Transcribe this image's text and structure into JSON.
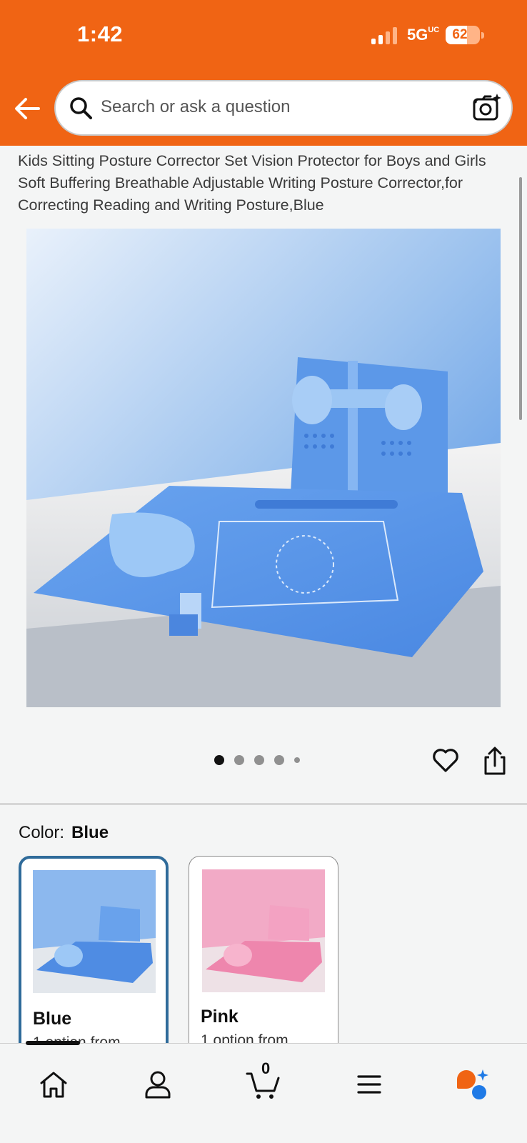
{
  "status": {
    "time": "1:42",
    "network": "5G",
    "network_sup": "UC",
    "battery": "62",
    "battery_level": 0.62
  },
  "search": {
    "placeholder": "Search or ask a question"
  },
  "product": {
    "title": "Kids Sitting Posture Corrector Set Vision Protector for Boys and Girls Soft Buffering Breathable Adjustable Writing Posture Corrector,for Correcting Reading and Writing Posture,Blue",
    "image_count": 5,
    "active_image": 0
  },
  "color": {
    "label": "Color:",
    "selected": "Blue",
    "options": [
      {
        "name": "Blue",
        "sub": "1 option from",
        "accent": "#5d9be8"
      },
      {
        "name": "Pink",
        "sub": "1 option from",
        "accent": "#f08fb1"
      }
    ]
  },
  "nav": {
    "cart_count": "0",
    "items": [
      "home-icon",
      "account-icon",
      "cart-icon",
      "menu-icon",
      "rufus-icon"
    ]
  },
  "colors": {
    "brand": "#f06414",
    "selected_border": "#2f6b9a",
    "rufus_orange": "#f06414",
    "rufus_blue": "#1f7ae6"
  }
}
